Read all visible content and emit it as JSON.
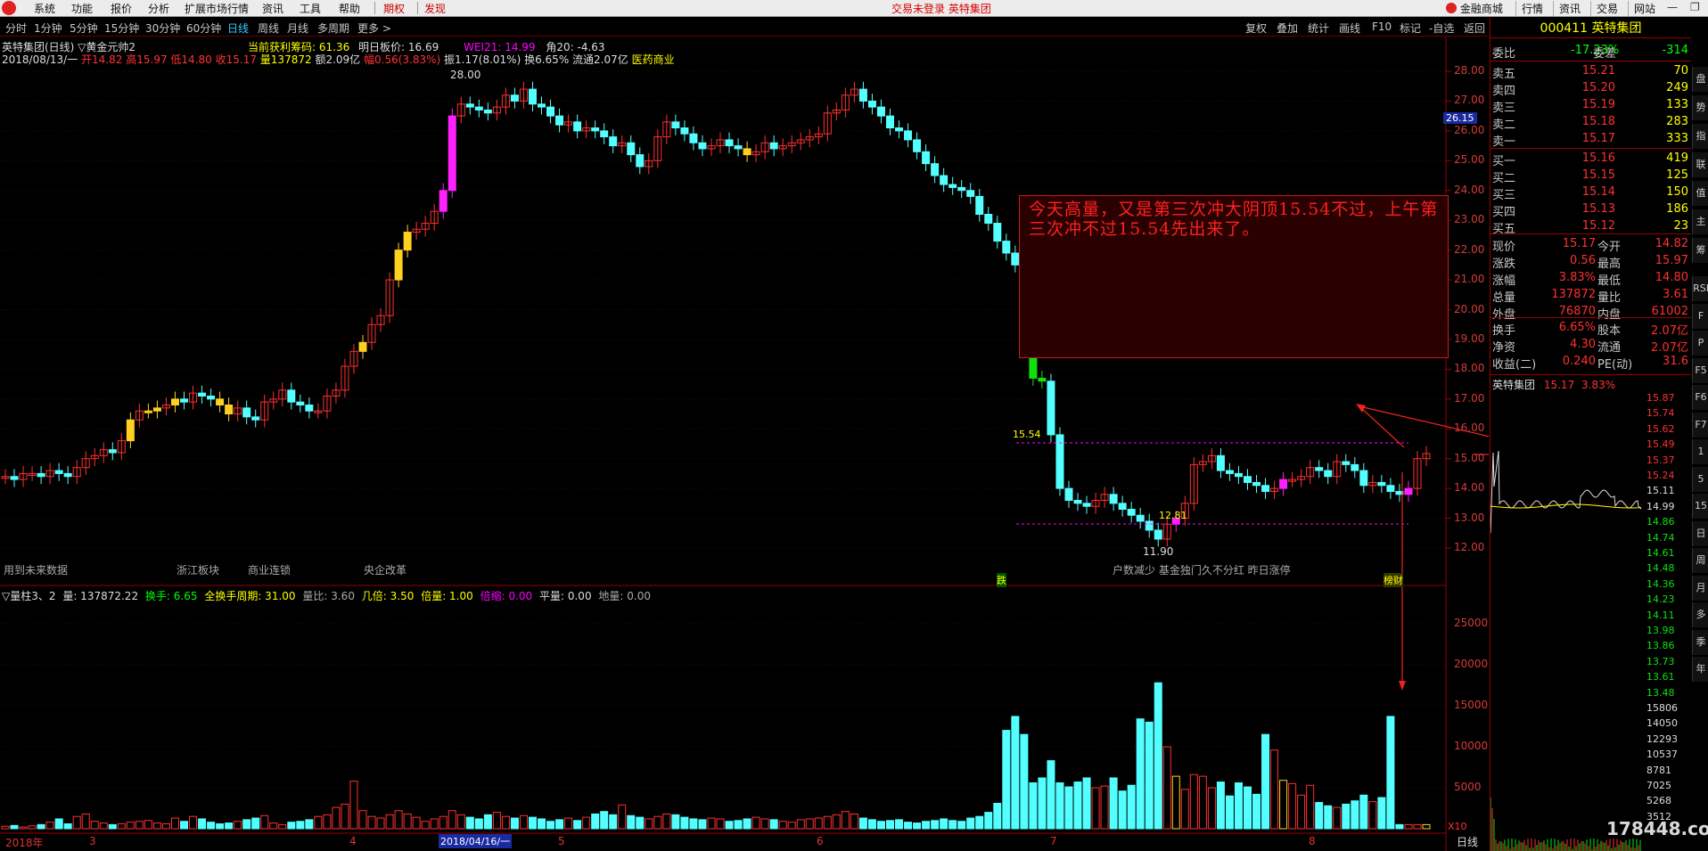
{
  "menu": {
    "items": [
      "系统",
      "功能",
      "报价",
      "分析",
      "扩展市场行情",
      "资讯",
      "工具",
      "帮助"
    ],
    "red_items": [
      "期权",
      "发现"
    ],
    "window_title": "交易未登录  英特集团",
    "right_buttons": [
      "金融商城",
      "行情",
      "资讯",
      "交易",
      "网站"
    ]
  },
  "period_tabs": [
    "分时",
    "1分钟",
    "5分钟",
    "15分钟",
    "30分钟",
    "60分钟",
    "日线",
    "周线",
    "月线",
    "多周期",
    "更多 >"
  ],
  "active_period": "日线",
  "toolbar_right": [
    "复权",
    "叠加",
    "统计",
    "画线",
    "F10",
    "标记",
    "-自选",
    "返回"
  ],
  "main_chart": {
    "title_line": "英特集团(日线) ▽黄金元帅2",
    "indicators": {
      "profit_label": "当前获利筹码: 61.36",
      "next_price_label": "明日板价: 16.69",
      "wei_label": "WEI21: 14.99",
      "jiao_label": "角20: -4.63"
    },
    "ohlc_line": {
      "date": "2018/08/13/一",
      "open": "开14.82",
      "high": "高15.97",
      "low": "低14.80",
      "close": "收15.17",
      "vol": "量137872",
      "amt": "额2.09亿",
      "chg": "幅0.56(3.83%)",
      "amp": "振1.17(8.01%)",
      "turn": "换6.65%",
      "float": "流通2.07亿",
      "sector": "医药商业"
    },
    "y_ticks": [
      "28.00",
      "27.00",
      "26.00",
      "25.00",
      "24.00",
      "23.00",
      "22.00",
      "21.00",
      "20.00",
      "19.00",
      "18.00",
      "17.00",
      "16.00",
      "15.00",
      "14.00",
      "13.00",
      "12.00"
    ],
    "current_price_tag": "26.15",
    "max_label": "28.00",
    "min_label": "11.90",
    "line_1554": "15.54",
    "line_1281": "12.81",
    "note_text": "今天高量，又是第三次冲大阴顶15.54不过，上午第三次冲不过15.54先出来了。",
    "bottom_labels": [
      "用到未来数据",
      "浙江板块",
      "商业连锁",
      "央企改革",
      "户数减少 基金独门久不分红 昨日涨停"
    ],
    "markers": [
      "跌",
      "榜财"
    ]
  },
  "volume_chart": {
    "header": {
      "name": "▽量柱3、2",
      "vol": "量: 137872.22",
      "huanshou": "换手: 6.65",
      "quanhuan": "全换手周期: 31.00",
      "liangbi": "量比: 3.60",
      "jibei": "几倍: 3.50",
      "beiliang": "倍量: 1.00",
      "beisuo": "倍缩: 0.00",
      "pingliang": "平量: 0.00",
      "diliang": "地量: 0.00"
    },
    "y_ticks": [
      "25000",
      "20000",
      "15000",
      "10000",
      "5000"
    ],
    "scale_label": "X10",
    "x_labels": [
      "2018年",
      "3",
      "4",
      "2018/04/16/一",
      "5",
      "6",
      "7",
      "8"
    ],
    "tab_label": "日线"
  },
  "right_panel": {
    "code": "000411",
    "name": "英特集团",
    "weibi_label": "委比",
    "weibi": "-17.23%",
    "weicha_label": "委差",
    "weicha": "-314",
    "asks": [
      {
        "label": "卖五",
        "price": "15.21",
        "vol": "70"
      },
      {
        "label": "卖四",
        "price": "15.20",
        "vol": "249"
      },
      {
        "label": "卖三",
        "price": "15.19",
        "vol": "133"
      },
      {
        "label": "卖二",
        "price": "15.18",
        "vol": "283"
      },
      {
        "label": "卖一",
        "price": "15.17",
        "vol": "333"
      }
    ],
    "bids": [
      {
        "label": "买一",
        "price": "15.16",
        "vol": "419"
      },
      {
        "label": "买二",
        "price": "15.15",
        "vol": "125"
      },
      {
        "label": "买三",
        "price": "15.14",
        "vol": "150"
      },
      {
        "label": "买四",
        "price": "15.13",
        "vol": "186"
      },
      {
        "label": "买五",
        "price": "15.12",
        "vol": "23"
      }
    ],
    "stats": [
      {
        "l1": "现价",
        "v1": "15.17",
        "l2": "今开",
        "v2": "14.82"
      },
      {
        "l1": "涨跌",
        "v1": "0.56",
        "l2": "最高",
        "v2": "15.97"
      },
      {
        "l1": "涨幅",
        "v1": "3.83%",
        "l2": "最低",
        "v2": "14.80"
      },
      {
        "l1": "总量",
        "v1": "137872",
        "l2": "量比",
        "v2": "3.61"
      },
      {
        "l1": "外盘",
        "v1": "76870",
        "l2": "内盘",
        "v2": "61002"
      }
    ],
    "stats2": [
      {
        "l1": "换手",
        "v1": "6.65%",
        "l2": "股本",
        "v2": "2.07亿"
      },
      {
        "l1": "净资",
        "v1": "4.30",
        "l2": "流通",
        "v2": "2.07亿"
      },
      {
        "l1": "收益(二)",
        "v1": "0.240",
        "l2": "PE(动)",
        "v2": "31.6"
      }
    ],
    "mini_title": "英特集团",
    "mini_price": "15.17",
    "mini_pct": "3.83%",
    "mini_ticks": [
      "15.87",
      "15.74",
      "15.62",
      "15.49",
      "15.37",
      "15.24",
      "15.11",
      "14.99",
      "14.86",
      "14.74",
      "14.61",
      "14.48",
      "14.36",
      "14.23",
      "14.11",
      "13.98",
      "13.86",
      "13.73",
      "13.61",
      "13.48",
      "15806",
      "14050",
      "12293",
      "10537",
      "8781",
      "7025",
      "5268",
      "3512"
    ],
    "side_tabs": [
      "盘",
      "势",
      "指",
      "联",
      "值",
      "主",
      "筹",
      "RSI",
      "F",
      "P",
      "F5",
      "F6",
      "F7",
      "1",
      "5",
      "15",
      "日",
      "周",
      "月",
      "多",
      "季",
      "年"
    ]
  },
  "watermark": "178448.com"
}
